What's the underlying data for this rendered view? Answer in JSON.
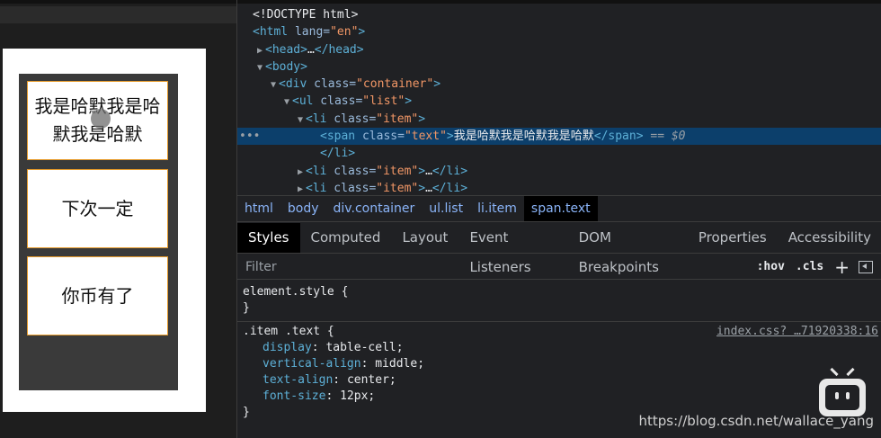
{
  "preview": {
    "items": [
      "我是哈默我是哈默我是哈默",
      "下次一定",
      "你币有了"
    ]
  },
  "dom": {
    "lines": [
      {
        "text": "<!DOCTYPE html>"
      },
      {
        "tag_open": "<html",
        "attr": " lang=",
        "val": "\"en\"",
        "tag_close": ">"
      },
      {
        "tag_open": "<head>",
        "mid": "…",
        "tag_close": "</head>"
      },
      {
        "tag_open": "<body>"
      },
      {
        "tag_open": "<div",
        "attr": " class=",
        "val": "\"container\"",
        "tag_close": ">"
      },
      {
        "tag_open": "<ul",
        "attr": " class=",
        "val": "\"list\"",
        "tag_close": ">"
      },
      {
        "tag_open": "<li",
        "attr": " class=",
        "val": "\"item\"",
        "tag_close": ">"
      },
      {
        "tag_open": "<span",
        "attr": " class=",
        "val": "\"text\"",
        "tag_close": ">",
        "text": "我是哈默我是哈默我是哈默",
        "end": "</span>",
        "eq": " == $0"
      },
      {
        "tag_close": "</li>"
      },
      {
        "tag_open": "<li",
        "attr": " class=",
        "val": "\"item\"",
        "tag_close": ">",
        "mid": "…",
        "end": "</li>"
      },
      {
        "tag_open": "<li",
        "attr": " class=",
        "val": "\"item\"",
        "tag_close": ">",
        "mid": "…",
        "end": "</li>"
      }
    ]
  },
  "breadcrumbs": [
    "html",
    "body",
    "div.container",
    "ul.list",
    "li.item",
    "span.text"
  ],
  "tabs": [
    "Styles",
    "Computed",
    "Layout",
    "Event Listeners",
    "DOM Breakpoints",
    "Properties",
    "Accessibility"
  ],
  "filter": {
    "placeholder": "Filter",
    "hov": ":hov",
    "cls": ".cls",
    "plus": "+"
  },
  "styles": {
    "element_style": "element.style {",
    "close1": "}",
    "rule_selector": ".item .text {",
    "source": "index.css? …71920338:16",
    "props": [
      {
        "name": "display",
        "value": "table-cell;"
      },
      {
        "name": "vertical-align",
        "value": "middle;"
      },
      {
        "name": "text-align",
        "value": "center;"
      },
      {
        "name": "font-size",
        "value": "12px;"
      }
    ],
    "close2": "}"
  },
  "watermark": "https://blog.csdn.net/wallace_yang"
}
